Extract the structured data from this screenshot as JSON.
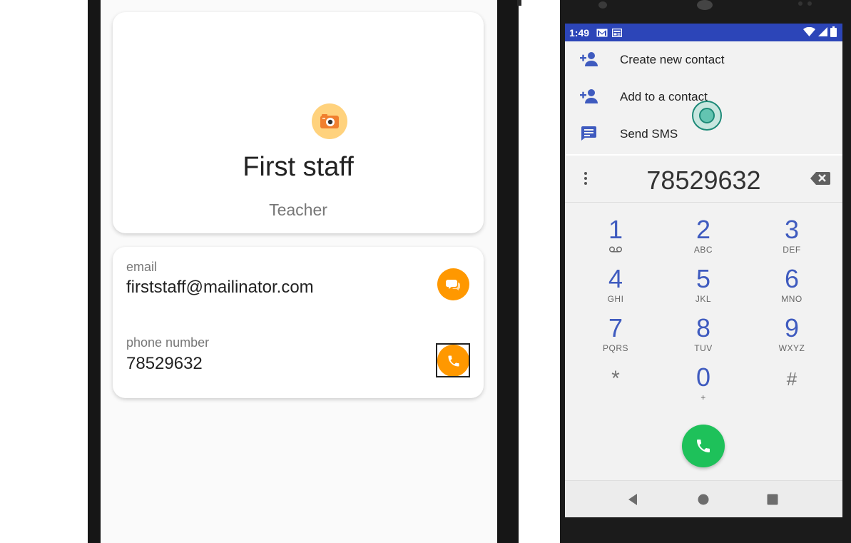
{
  "left_app": {
    "profile": {
      "name": "First staff",
      "role": "Teacher"
    },
    "contact": {
      "email_label": "email",
      "email_value": "firststaff@mailinator.com",
      "phone_label": "phone number",
      "phone_value": "78529632"
    },
    "colors": {
      "accent": "#ff9800",
      "avatar_bg": "#ffd27d"
    },
    "icons": {
      "avatar": "camera-icon",
      "email_action": "message-icon",
      "phone_action": "phone-icon"
    }
  },
  "right_app": {
    "status_bar": {
      "time": "1:49",
      "icons": [
        "gmail-icon",
        "news-icon",
        "wifi-icon",
        "signal-icon",
        "battery-icon"
      ]
    },
    "suggestions": [
      {
        "label": "Create new contact",
        "icon": "add-person-icon"
      },
      {
        "label": "Add to a contact",
        "icon": "add-person-icon"
      },
      {
        "label": "Send SMS",
        "icon": "sms-icon"
      }
    ],
    "dialed_number": "78529632",
    "keypad": [
      {
        "digit": "1",
        "letters": "voicemail"
      },
      {
        "digit": "2",
        "letters": "ABC"
      },
      {
        "digit": "3",
        "letters": "DEF"
      },
      {
        "digit": "4",
        "letters": "GHI"
      },
      {
        "digit": "5",
        "letters": "JKL"
      },
      {
        "digit": "6",
        "letters": "MNO"
      },
      {
        "digit": "7",
        "letters": "PQRS"
      },
      {
        "digit": "8",
        "letters": "TUV"
      },
      {
        "digit": "9",
        "letters": "WXYZ"
      },
      {
        "digit": "*",
        "letters": ""
      },
      {
        "digit": "0",
        "letters": "+"
      },
      {
        "digit": "#",
        "letters": ""
      }
    ],
    "colors": {
      "status_bar": "#2c45b8",
      "digit": "#3f5bbf",
      "call": "#1ec15a"
    }
  }
}
